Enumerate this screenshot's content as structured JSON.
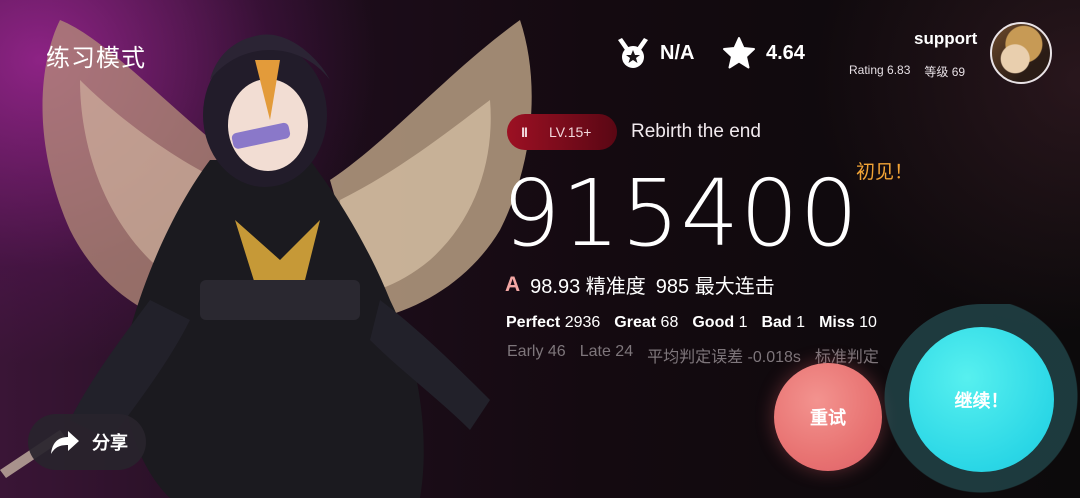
{
  "header": {
    "mode_title": "练习模式"
  },
  "stats": {
    "medal_value": "N/A",
    "difficulty_value": "4.64"
  },
  "user": {
    "name": "support",
    "rating": "Rating 6.83",
    "level": "等级 69"
  },
  "song": {
    "badge_icon": "II",
    "level": "LV.15+",
    "title": "Rebirth the end"
  },
  "result": {
    "first_clear": "初见！",
    "score": "915400",
    "grade": "A",
    "accuracy": "98.93 精准度",
    "max_combo": "985 最大连击"
  },
  "judgements": [
    {
      "label": "Perfect",
      "value": "2936"
    },
    {
      "label": "Great",
      "value": "68"
    },
    {
      "label": "Good",
      "value": "1"
    },
    {
      "label": "Bad",
      "value": "1"
    },
    {
      "label": "Miss",
      "value": "10"
    }
  ],
  "timing": {
    "early": "Early 46",
    "late": "Late 24",
    "avg_offset": "平均判定误差 -0.018s",
    "std": "标准判定"
  },
  "actions": {
    "share": "分享",
    "retry": "重试",
    "continue": "继续！"
  },
  "colors": {
    "accent_orange": "#f2a436",
    "retry_pink": "#e87372",
    "continue_cyan": "#2bd7e6",
    "badge_red": "#9c1023"
  }
}
